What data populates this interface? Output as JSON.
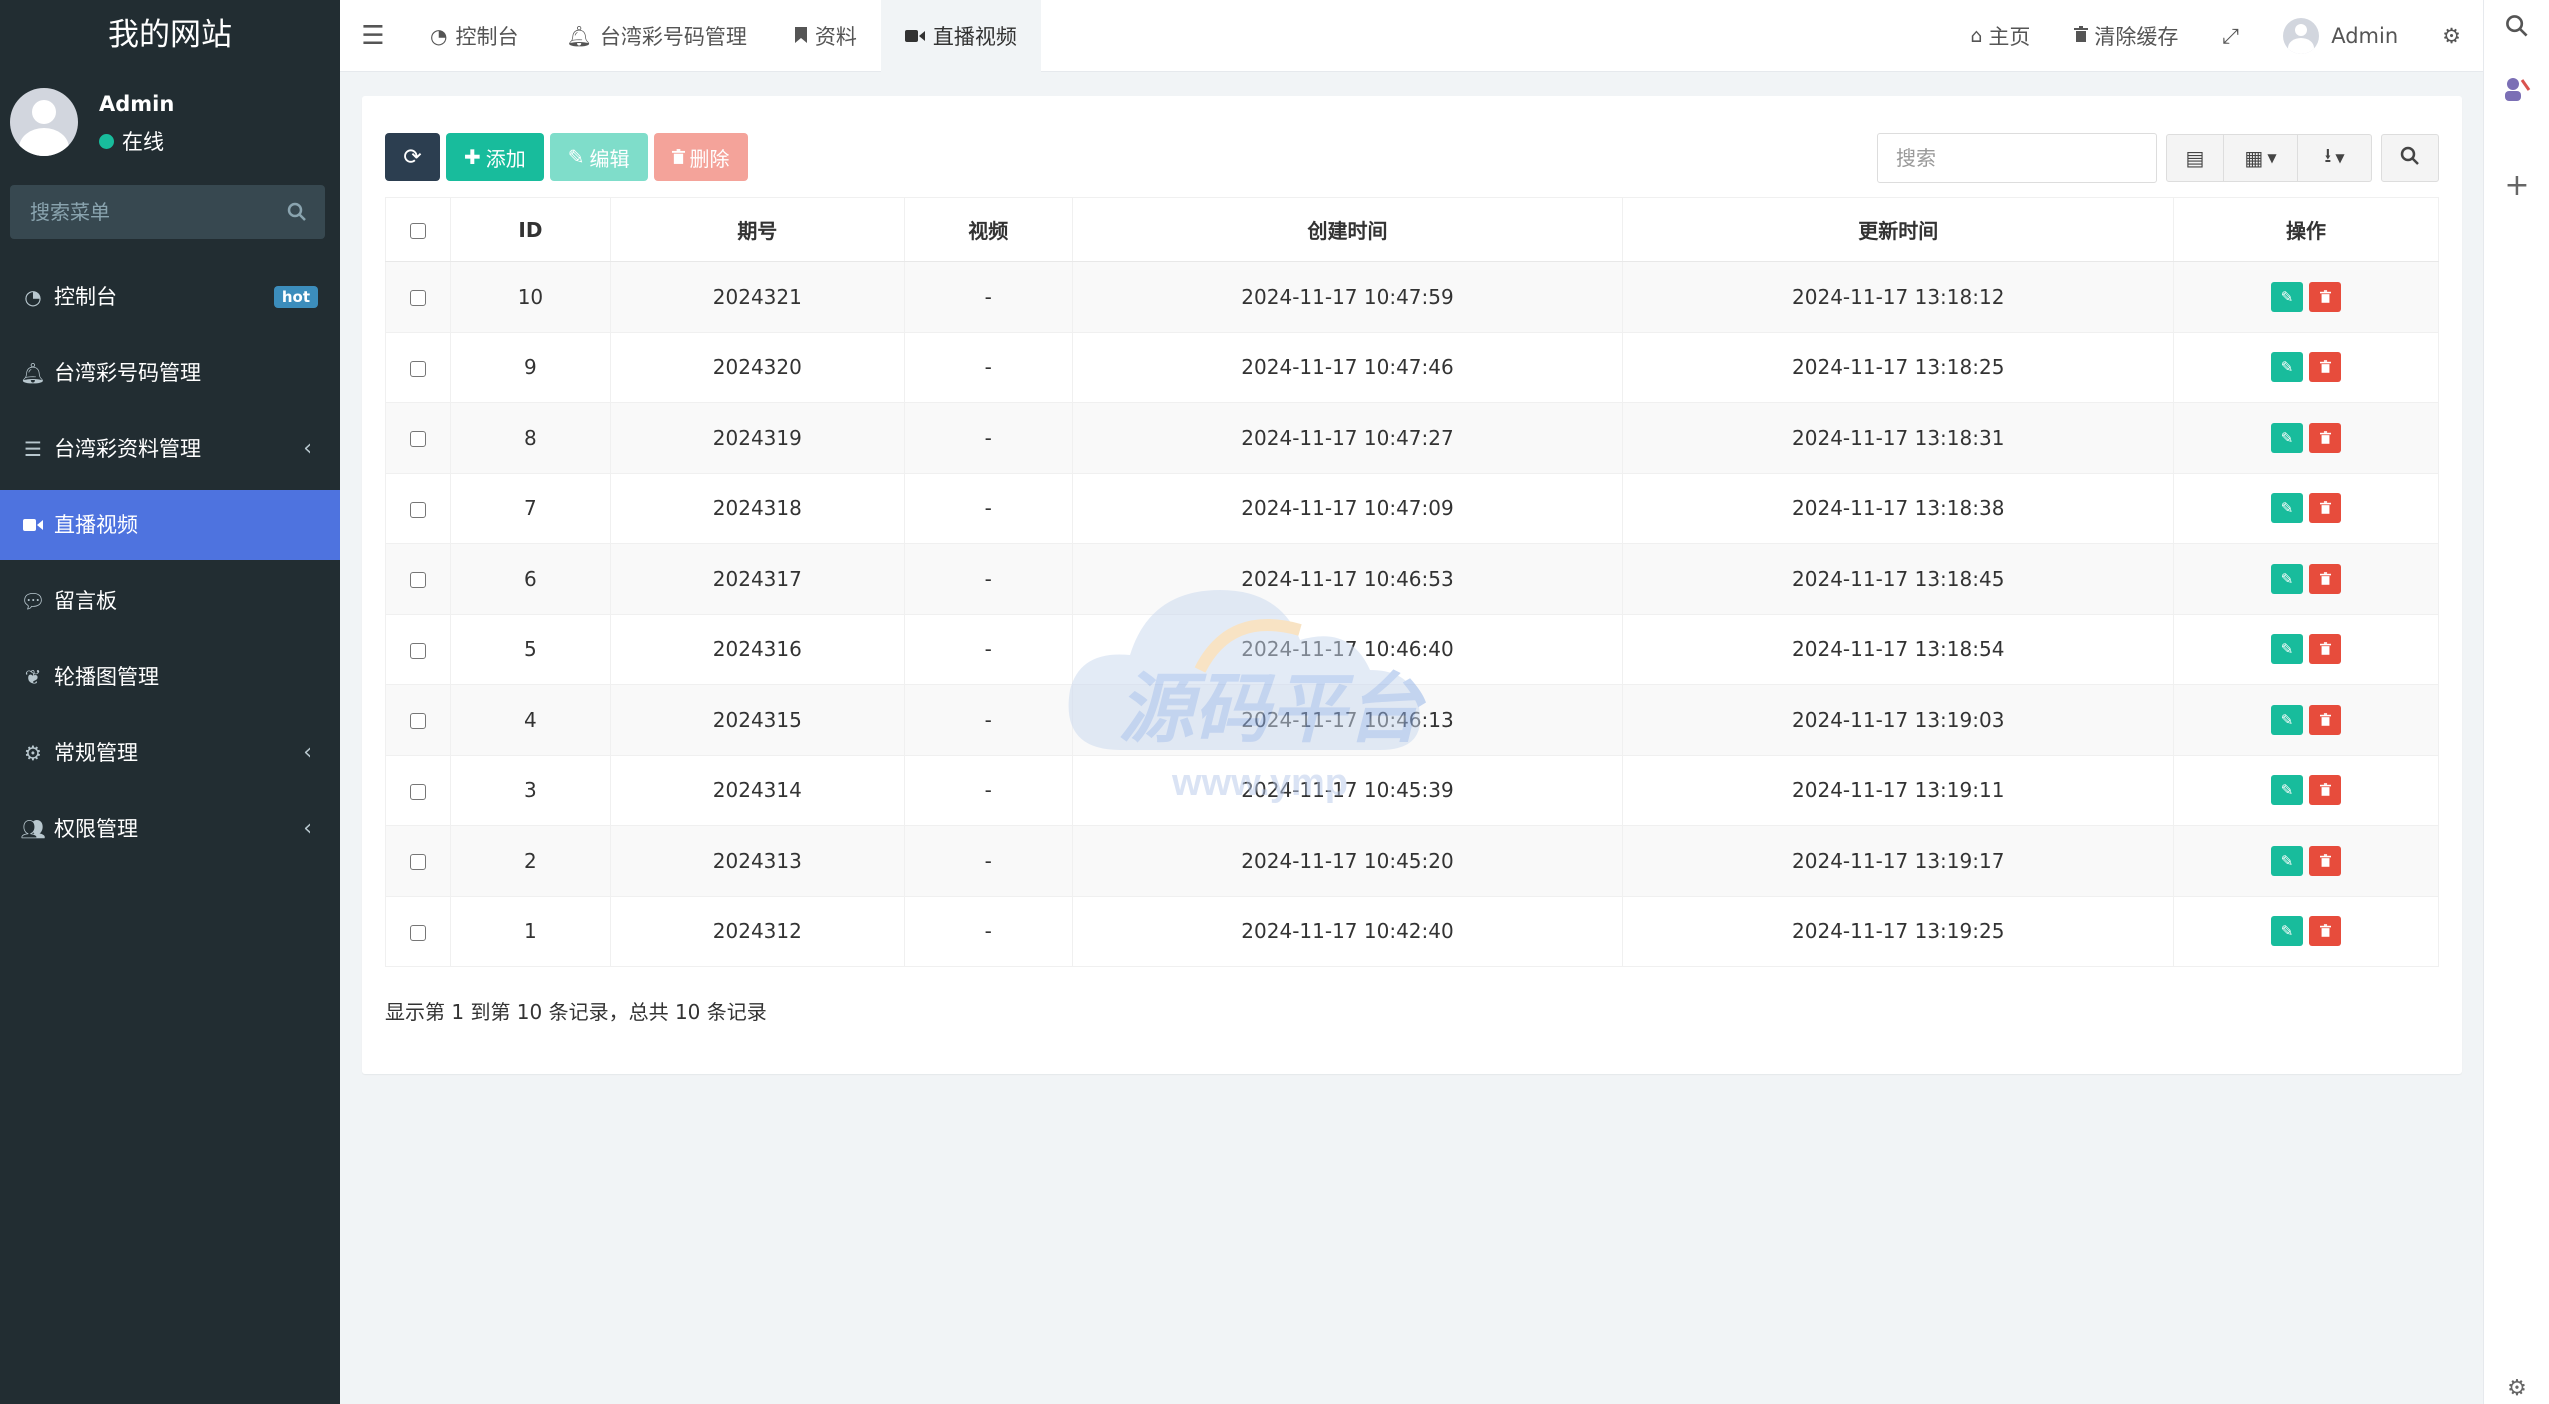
{
  "sidebar": {
    "logo": "我的网站",
    "user": {
      "name": "Admin",
      "status": "在线"
    },
    "search_placeholder": "搜索菜单",
    "items": [
      {
        "label": "控制台",
        "icon": "dashboard-icon",
        "badge": "hot"
      },
      {
        "label": "台湾彩号码管理",
        "icon": "bell-icon"
      },
      {
        "label": "台湾彩资料管理",
        "icon": "list-icon",
        "has_children": true
      },
      {
        "label": "直播视频",
        "icon": "video-camera-icon",
        "active": true
      },
      {
        "label": "留言板",
        "icon": "comment-icon"
      },
      {
        "label": "轮播图管理",
        "icon": "leaf-icon"
      },
      {
        "label": "常规管理",
        "icon": "cogs-icon",
        "has_children": true
      },
      {
        "label": "权限管理",
        "icon": "users-icon",
        "has_children": true
      }
    ]
  },
  "topbar": {
    "tabs": [
      {
        "label": "控制台",
        "icon": "dashboard-icon"
      },
      {
        "label": "台湾彩号码管理",
        "icon": "bell-icon"
      },
      {
        "label": "资料",
        "icon": "bookmark-icon"
      },
      {
        "label": "直播视频",
        "icon": "video-camera-icon",
        "active": true
      }
    ],
    "home": "主页",
    "clear_cache": "清除缓存",
    "user": "Admin"
  },
  "toolbar": {
    "add": "添加",
    "edit": "编辑",
    "delete": "删除",
    "search_placeholder": "搜索"
  },
  "table": {
    "columns": [
      "ID",
      "期号",
      "视频",
      "创建时间",
      "更新时间",
      "操作"
    ],
    "rows": [
      [
        "10",
        "2024321",
        "-",
        "2024-11-17 10:47:59",
        "2024-11-17 13:18:12"
      ],
      [
        "9",
        "2024320",
        "-",
        "2024-11-17 10:47:46",
        "2024-11-17 13:18:25"
      ],
      [
        "8",
        "2024319",
        "-",
        "2024-11-17 10:47:27",
        "2024-11-17 13:18:31"
      ],
      [
        "7",
        "2024318",
        "-",
        "2024-11-17 10:47:09",
        "2024-11-17 13:18:38"
      ],
      [
        "6",
        "2024317",
        "-",
        "2024-11-17 10:46:53",
        "2024-11-17 13:18:45"
      ],
      [
        "5",
        "2024316",
        "-",
        "2024-11-17 10:46:40",
        "2024-11-17 13:18:54"
      ],
      [
        "4",
        "2024315",
        "-",
        "2024-11-17 10:46:13",
        "2024-11-17 13:19:03"
      ],
      [
        "3",
        "2024314",
        "-",
        "2024-11-17 10:45:39",
        "2024-11-17 13:19:11"
      ],
      [
        "2",
        "2024313",
        "-",
        "2024-11-17 10:45:20",
        "2024-11-17 13:19:17"
      ],
      [
        "1",
        "2024312",
        "-",
        "2024-11-17 10:42:40",
        "2024-11-17 13:19:25"
      ]
    ]
  },
  "pagination": {
    "info": "显示第 1 到第 10 条记录，总共 10 条记录"
  },
  "watermark": {
    "text": "源码平台",
    "url": "www.ymp"
  },
  "colors": {
    "sidebar_bg": "#222d32",
    "active_menu": "#4e73df",
    "primary_green": "#18bc9c",
    "danger_red": "#e74c3c",
    "dark_button": "#2c3e50"
  }
}
